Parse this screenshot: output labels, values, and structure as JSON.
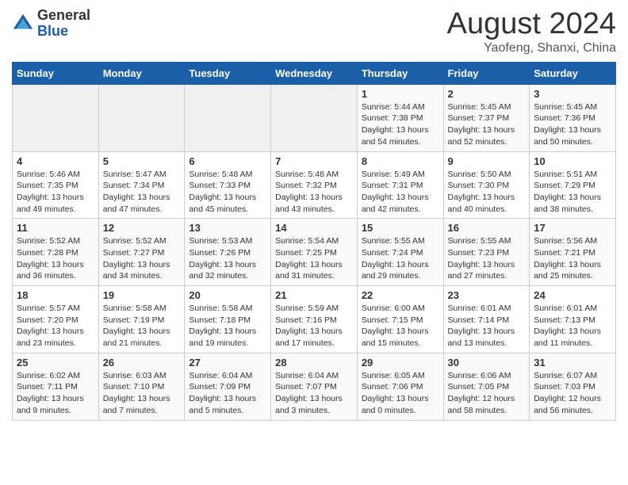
{
  "header": {
    "logo": {
      "general": "General",
      "blue": "Blue"
    },
    "title": "August 2024",
    "location": "Yaofeng, Shanxi, China"
  },
  "days_of_week": [
    "Sunday",
    "Monday",
    "Tuesday",
    "Wednesday",
    "Thursday",
    "Friday",
    "Saturday"
  ],
  "weeks": [
    [
      {
        "day": "",
        "info": ""
      },
      {
        "day": "",
        "info": ""
      },
      {
        "day": "",
        "info": ""
      },
      {
        "day": "",
        "info": ""
      },
      {
        "day": "1",
        "info": "Sunrise: 5:44 AM\nSunset: 7:38 PM\nDaylight: 13 hours and 54 minutes."
      },
      {
        "day": "2",
        "info": "Sunrise: 5:45 AM\nSunset: 7:37 PM\nDaylight: 13 hours and 52 minutes."
      },
      {
        "day": "3",
        "info": "Sunrise: 5:45 AM\nSunset: 7:36 PM\nDaylight: 13 hours and 50 minutes."
      }
    ],
    [
      {
        "day": "4",
        "info": "Sunrise: 5:46 AM\nSunset: 7:35 PM\nDaylight: 13 hours and 49 minutes."
      },
      {
        "day": "5",
        "info": "Sunrise: 5:47 AM\nSunset: 7:34 PM\nDaylight: 13 hours and 47 minutes."
      },
      {
        "day": "6",
        "info": "Sunrise: 5:48 AM\nSunset: 7:33 PM\nDaylight: 13 hours and 45 minutes."
      },
      {
        "day": "7",
        "info": "Sunrise: 5:48 AM\nSunset: 7:32 PM\nDaylight: 13 hours and 43 minutes."
      },
      {
        "day": "8",
        "info": "Sunrise: 5:49 AM\nSunset: 7:31 PM\nDaylight: 13 hours and 42 minutes."
      },
      {
        "day": "9",
        "info": "Sunrise: 5:50 AM\nSunset: 7:30 PM\nDaylight: 13 hours and 40 minutes."
      },
      {
        "day": "10",
        "info": "Sunrise: 5:51 AM\nSunset: 7:29 PM\nDaylight: 13 hours and 38 minutes."
      }
    ],
    [
      {
        "day": "11",
        "info": "Sunrise: 5:52 AM\nSunset: 7:28 PM\nDaylight: 13 hours and 36 minutes."
      },
      {
        "day": "12",
        "info": "Sunrise: 5:52 AM\nSunset: 7:27 PM\nDaylight: 13 hours and 34 minutes."
      },
      {
        "day": "13",
        "info": "Sunrise: 5:53 AM\nSunset: 7:26 PM\nDaylight: 13 hours and 32 minutes."
      },
      {
        "day": "14",
        "info": "Sunrise: 5:54 AM\nSunset: 7:25 PM\nDaylight: 13 hours and 31 minutes."
      },
      {
        "day": "15",
        "info": "Sunrise: 5:55 AM\nSunset: 7:24 PM\nDaylight: 13 hours and 29 minutes."
      },
      {
        "day": "16",
        "info": "Sunrise: 5:55 AM\nSunset: 7:23 PM\nDaylight: 13 hours and 27 minutes."
      },
      {
        "day": "17",
        "info": "Sunrise: 5:56 AM\nSunset: 7:21 PM\nDaylight: 13 hours and 25 minutes."
      }
    ],
    [
      {
        "day": "18",
        "info": "Sunrise: 5:57 AM\nSunset: 7:20 PM\nDaylight: 13 hours and 23 minutes."
      },
      {
        "day": "19",
        "info": "Sunrise: 5:58 AM\nSunset: 7:19 PM\nDaylight: 13 hours and 21 minutes."
      },
      {
        "day": "20",
        "info": "Sunrise: 5:58 AM\nSunset: 7:18 PM\nDaylight: 13 hours and 19 minutes."
      },
      {
        "day": "21",
        "info": "Sunrise: 5:59 AM\nSunset: 7:16 PM\nDaylight: 13 hours and 17 minutes."
      },
      {
        "day": "22",
        "info": "Sunrise: 6:00 AM\nSunset: 7:15 PM\nDaylight: 13 hours and 15 minutes."
      },
      {
        "day": "23",
        "info": "Sunrise: 6:01 AM\nSunset: 7:14 PM\nDaylight: 13 hours and 13 minutes."
      },
      {
        "day": "24",
        "info": "Sunrise: 6:01 AM\nSunset: 7:13 PM\nDaylight: 13 hours and 11 minutes."
      }
    ],
    [
      {
        "day": "25",
        "info": "Sunrise: 6:02 AM\nSunset: 7:11 PM\nDaylight: 13 hours and 9 minutes."
      },
      {
        "day": "26",
        "info": "Sunrise: 6:03 AM\nSunset: 7:10 PM\nDaylight: 13 hours and 7 minutes."
      },
      {
        "day": "27",
        "info": "Sunrise: 6:04 AM\nSunset: 7:09 PM\nDaylight: 13 hours and 5 minutes."
      },
      {
        "day": "28",
        "info": "Sunrise: 6:04 AM\nSunset: 7:07 PM\nDaylight: 13 hours and 3 minutes."
      },
      {
        "day": "29",
        "info": "Sunrise: 6:05 AM\nSunset: 7:06 PM\nDaylight: 13 hours and 0 minutes."
      },
      {
        "day": "30",
        "info": "Sunrise: 6:06 AM\nSunset: 7:05 PM\nDaylight: 12 hours and 58 minutes."
      },
      {
        "day": "31",
        "info": "Sunrise: 6:07 AM\nSunset: 7:03 PM\nDaylight: 12 hours and 56 minutes."
      }
    ]
  ]
}
